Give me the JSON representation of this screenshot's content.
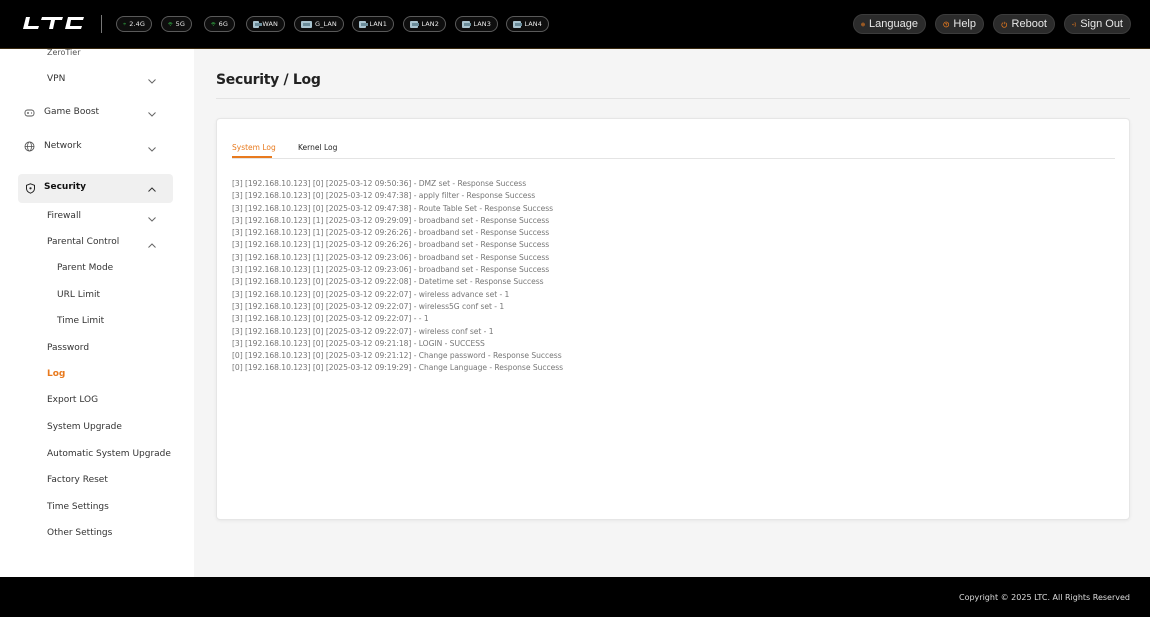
{
  "header": {
    "status_items": [
      {
        "label": "2.4G",
        "type": "wifi"
      },
      {
        "label": "5G",
        "type": "wifi"
      },
      {
        "label": "6G",
        "type": "wifi"
      },
      {
        "label": "WAN",
        "type": "port"
      },
      {
        "label": "G_LAN",
        "type": "port"
      },
      {
        "label": "LAN1",
        "type": "port"
      },
      {
        "label": "LAN2",
        "type": "port"
      },
      {
        "label": "LAN3",
        "type": "port"
      },
      {
        "label": "LAN4",
        "type": "port"
      }
    ],
    "buttons": {
      "language": "Language",
      "help": "Help",
      "reboot": "Reboot",
      "sign_out": "Sign Out"
    },
    "accent_color": "#e87a1e"
  },
  "sidebar": {
    "zerotier": "ZeroTier",
    "vpn": "VPN",
    "game_boost": "Game Boost",
    "network": "Network",
    "security": "Security",
    "firewall": "Firewall",
    "parental_control": "Parental Control",
    "parent_mode": "Parent Mode",
    "url_limit": "URL Limit",
    "time_limit": "Time Limit",
    "password": "Password",
    "log": "Log",
    "export_log": "Export LOG",
    "system_upgrade": "System Upgrade",
    "auto_upgrade": "Automatic System Upgrade",
    "factory_reset": "Factory Reset",
    "time_settings": "Time Settings",
    "other_settings": "Other Settings"
  },
  "main": {
    "title": "Security / Log",
    "tabs": {
      "system_log": "System Log",
      "kernel_log": "Kernel Log"
    },
    "log_lines": [
      "[3] [192.168.10.123] [0] [2025-03-12 09:50:36] - DMZ set - Response Success",
      "[3] [192.168.10.123] [0] [2025-03-12 09:47:38] - apply filter - Response Success",
      "[3] [192.168.10.123] [0] [2025-03-12 09:47:38] - Route Table Set - Response Success",
      "[3] [192.168.10.123] [1] [2025-03-12 09:29:09] - broadband set - Response Success",
      "[3] [192.168.10.123] [1] [2025-03-12 09:26:26] - broadband set - Response Success",
      "[3] [192.168.10.123] [1] [2025-03-12 09:26:26] - broadband set - Response Success",
      "[3] [192.168.10.123] [1] [2025-03-12 09:23:06] - broadband set - Response Success",
      "[3] [192.168.10.123] [1] [2025-03-12 09:23:06] - broadband set - Response Success",
      "[3] [192.168.10.123] [0] [2025-03-12 09:22:08] - Datetime set - Response Success",
      "[3] [192.168.10.123] [0] [2025-03-12 09:22:07] - wireless advance set - 1",
      "[3] [192.168.10.123] [0] [2025-03-12 09:22:07] - wireless5G conf set - 1",
      "[3] [192.168.10.123] [0] [2025-03-12 09:22:07] -  - 1",
      "[3] [192.168.10.123] [0] [2025-03-12 09:22:07] - wireless conf set - 1",
      "[3] [192.168.10.123] [0] [2025-03-12 09:21:18] - LOGIN - SUCCESS",
      "[0] [192.168.10.123] [0] [2025-03-12 09:21:12] - Change password - Response Success",
      "[0] [192.168.10.123] [0] [2025-03-12 09:19:29] - Change Language - Response Success"
    ]
  },
  "footer": {
    "copyright": "Copyright © 2025 LTC. All Rights Reserved"
  }
}
